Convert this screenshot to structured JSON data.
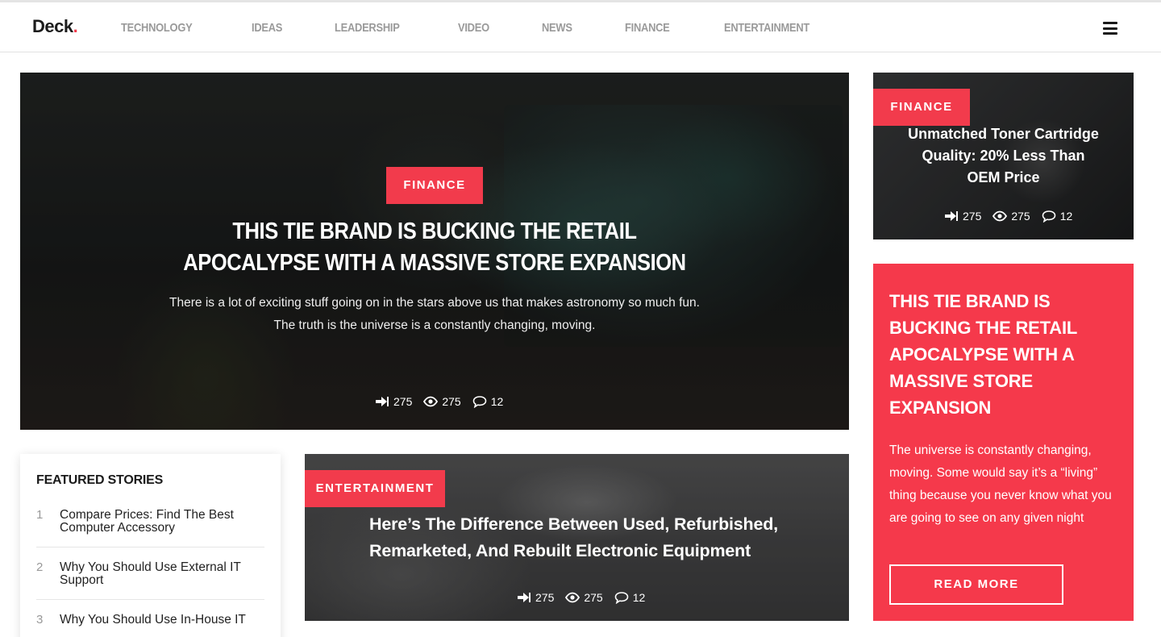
{
  "brand": {
    "name": "Deck",
    "dot": "."
  },
  "nav": {
    "items": [
      "TECHNOLOGY",
      "IDEAS",
      "LEADERSHIP",
      "VIDEO",
      "NEWS",
      "FINANCE",
      "ENTERTAINMENT"
    ]
  },
  "hero": {
    "tag": "FINANCE",
    "title": "THIS TIE BRAND IS BUCKING THE RETAIL APOCALYPSE WITH A MASSIVE STORE EXPANSION",
    "description": "There is a lot of exciting stuff going on in the stars above us that makes astronomy so much fun. The truth is the universe is a constantly changing, moving.",
    "meta": {
      "shares": "275",
      "views": "275",
      "comments": "12"
    }
  },
  "card_top": {
    "tag": "FINANCE",
    "title": "Unmatched Toner Cartridge Quality: 20% Less Than OEM Price",
    "meta": {
      "shares": "275",
      "views": "275",
      "comments": "12"
    }
  },
  "card_red": {
    "title": "THIS TIE BRAND IS BUCKING THE RETAIL APOCALYPSE WITH A MASSIVE STORE EXPANSION",
    "description": "The universe is constantly changing, moving. Some would say it’s a “living” thing because you never know what you are going to see on any given night",
    "button": "READ MORE"
  },
  "featured": {
    "heading": "FEATURED STORIES",
    "items": [
      {
        "num": "1",
        "title": "Compare Prices: Find The Best Computer Accessory"
      },
      {
        "num": "2",
        "title": "Why You Should Use External IT Support"
      },
      {
        "num": "3",
        "title": "Why You Should Use In-House IT"
      }
    ]
  },
  "card_mid": {
    "tag": "ENTERTAINMENT",
    "title": "Here’s The Difference Between Used, Refurbished, Remarketed, And Rebuilt Electronic Equipment",
    "meta": {
      "shares": "275",
      "views": "275",
      "comments": "12"
    }
  },
  "colors": {
    "accent": "#f5394b",
    "nav_text": "#9a9a9a",
    "text_dark": "#1a1a1a"
  }
}
